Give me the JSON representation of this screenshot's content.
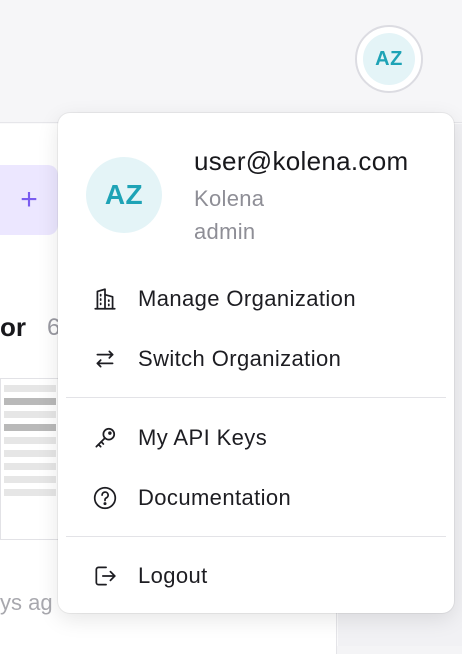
{
  "header": {
    "avatar_initials": "AZ"
  },
  "background": {
    "add_symbol": "+",
    "heading": "or",
    "heading_suffix": "6",
    "timestamp": "ys ag"
  },
  "user_menu": {
    "avatar_initials": "AZ",
    "email": "user@kolena.com",
    "organization": "Kolena",
    "role": "admin",
    "items": [
      {
        "label": "Manage Organization",
        "icon": "building-icon"
      },
      {
        "label": "Switch Organization",
        "icon": "swap-arrows-icon"
      },
      {
        "label": "My API Keys",
        "icon": "key-icon"
      },
      {
        "label": "Documentation",
        "icon": "help-circle-icon"
      },
      {
        "label": "Logout",
        "icon": "logout-icon"
      }
    ]
  },
  "colors": {
    "accent": "#1ea3b6",
    "avatar_bg": "#e4f4f7",
    "add_button_bg": "#ece7ff",
    "add_button_fg": "#7a5cf0"
  }
}
